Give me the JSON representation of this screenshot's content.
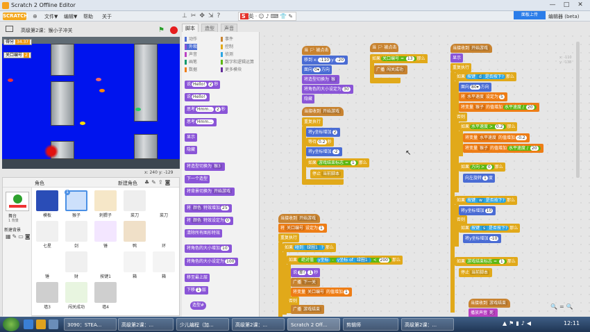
{
  "window": {
    "title": "Scratch 2 Offline Editor",
    "controls": [
      "—",
      "□",
      "✕"
    ]
  },
  "menu": {
    "logo": "SCRATCH",
    "items": [
      "文件▼",
      "编辑▼",
      "帮助",
      "关于"
    ]
  },
  "topright": {
    "online_badge": "面板上传",
    "editor_label": "编辑器 (beta)"
  },
  "stage": {
    "project_name": "高级第2课：猴小子冲关",
    "monitor1_label": "得分",
    "monitor1_value": "34.37",
    "monitor2_label": "关口编号",
    "monitor2_value": "2",
    "coords": "x: 240  y: -129"
  },
  "sprites": {
    "header": "角色",
    "new_sprite": "新建角色",
    "stage_label": "舞台",
    "stage_count": "1 背景",
    "new_backdrop": "新建背景",
    "items": [
      {
        "name": "模板"
      },
      {
        "name": "猴子",
        "badge": "1"
      },
      {
        "name": "刺猬子"
      },
      {
        "name": "菜刀"
      },
      {
        "name": "菜刀"
      },
      {
        "name": "七星"
      },
      {
        "name": "剑"
      },
      {
        "name": "锤"
      },
      {
        "name": "鸭"
      },
      {
        "name": "环"
      },
      {
        "name": "锤"
      },
      {
        "name": "财"
      },
      {
        "name": "按键1"
      },
      {
        "name": "箱"
      },
      {
        "name": "箱"
      },
      {
        "name": "墙3"
      },
      {
        "name": "闯关成功"
      },
      {
        "name": "墙4"
      }
    ]
  },
  "tabs": [
    "脚本",
    "造型",
    "声音"
  ],
  "categories": [
    {
      "label": "动作",
      "color": "#4a6cd4"
    },
    {
      "label": "事件",
      "color": "#c88330"
    },
    {
      "label": "外观",
      "color": "#8a55d7",
      "active": true
    },
    {
      "label": "控制",
      "color": "#e1a91a"
    },
    {
      "label": "声音",
      "color": "#bb42c3"
    },
    {
      "label": "侦测",
      "color": "#2ca5e2"
    },
    {
      "label": "画笔",
      "color": "#0e9a6c"
    },
    {
      "label": "数字和逻辑运算",
      "color": "#5cb712"
    },
    {
      "label": "数据",
      "color": "#ee7d16"
    },
    {
      "label": "更多模块",
      "color": "#632d99"
    }
  ],
  "palette": {
    "p1": [
      "说",
      "Hello!",
      "2",
      "秒"
    ],
    "p2": [
      "说",
      "Hello!"
    ],
    "p3": [
      "思考",
      "Hmm...",
      "2",
      "秒"
    ],
    "p4": [
      "思考",
      "Hmm..."
    ],
    "p5": "显示",
    "p6": "隐藏",
    "p7": [
      "将造型切换为",
      "猴3"
    ],
    "p8": "下一个造型",
    "p9": [
      "将背景切换为",
      "开始游戏"
    ],
    "p10": [
      "将",
      "颜色",
      "特效增加",
      "25"
    ],
    "p11": [
      "将",
      "颜色",
      "特效设定为",
      "0"
    ],
    "p12": "清除所有图形特效",
    "p13": [
      "将角色的大小增加",
      "10"
    ],
    "p14": [
      "将角色的大小设定为",
      "100"
    ],
    "p15": "移至最上层",
    "p16": [
      "下移",
      "1",
      "层"
    ],
    "p17": [
      "造型",
      "#"
    ]
  },
  "scripts": {
    "s1": {
      "hat": "当 🏳 被点击",
      "b1": [
        "移到 x:",
        "-110",
        "y:",
        "-20"
      ],
      "b2": [
        "面向",
        "0▾",
        "方向"
      ],
      "b3": [
        "将造型切换为",
        "猴"
      ],
      "b4": [
        "将角色的大小设定为",
        "30"
      ],
      "b5": "隐藏"
    },
    "s2": {
      "hat": [
        "当 🏳 被点击"
      ],
      "b1": [
        "如果",
        "关口编号",
        "=",
        "13",
        "那么"
      ],
      "b2": [
        "广播",
        "闯关成功"
      ]
    },
    "s3": {
      "hat": [
        "当接收到",
        "开始游戏"
      ],
      "loop": "重复执行",
      "b1": [
        "将y坐标增加",
        "2"
      ],
      "b2": [
        "等待",
        "0.2",
        "秒"
      ],
      "b3": [
        "将y坐标增加",
        "-2"
      ],
      "b4": [
        "如果",
        "游戏结束标志",
        "=",
        "1",
        "那么"
      ],
      "b5": [
        "停止",
        "当前脚本"
      ]
    },
    "s4": {
      "hat": [
        "当接收到",
        "开始游戏"
      ],
      "b0": "显示",
      "loop": "重复执行",
      "if1": [
        "如果",
        "按键",
        "d",
        "是否按下?",
        "那么"
      ],
      "b1": [
        "面向",
        "80▾",
        "方向"
      ],
      "b2": [
        "将",
        "水平速度",
        "设定为",
        "5"
      ],
      "b3": [
        "将变量",
        "猴子",
        "的值增加",
        "水平速度",
        "/",
        "20"
      ],
      "else": "否则",
      "if2": [
        "如果",
        "水平速度",
        ">",
        "0.2",
        "那么"
      ],
      "b4": [
        "将变量",
        "水平速度",
        "的值增加",
        "-0.2"
      ],
      "b5": [
        "将变量",
        "猴子",
        "的值增加",
        "水平速度",
        "/",
        "20"
      ],
      "if3": [
        "如果",
        "方向",
        ">",
        "0",
        "那么"
      ],
      "b6": [
        "向左旋转",
        "1",
        "度"
      ],
      "if4": [
        "如果",
        "按键",
        "w",
        "是否按下?",
        "那么"
      ],
      "b7": [
        "将y坐标增加",
        "10"
      ],
      "else2": "否则",
      "if5": [
        "如果",
        "按键",
        "s",
        "是否按下?",
        "那么"
      ],
      "b8": [
        "将y坐标增加",
        "-10"
      ],
      "if6": [
        "如果",
        "游戏结束标志",
        "=",
        "1",
        "那么"
      ],
      "b9": [
        "停止",
        "当前脚本"
      ]
    },
    "s5": {
      "hat": [
        "当接收到",
        "开始游戏"
      ],
      "b1": [
        "将",
        "关口编号",
        "设定为",
        "1"
      ],
      "loop": "重复执行",
      "if1": [
        "如果",
        "碰到",
        "绿圈1",
        "?",
        "那么"
      ],
      "if2": [
        "如果",
        "绝对值",
        "y坐标",
        "-",
        "y坐标",
        "of",
        "绿圈1",
        "<",
        "200",
        "那么"
      ],
      "b2": [
        "说",
        "耶!",
        "1",
        "秒"
      ],
      "b3": [
        "广播",
        "下一关"
      ],
      "b4": [
        "将变量",
        "关口编号",
        "的值增加",
        "1"
      ],
      "else": "否则",
      "b5": [
        "广播",
        "游戏结束"
      ]
    },
    "s6": {
      "hat": [
        "当接收到",
        "游戏结束"
      ],
      "b1": [
        "播放声音",
        "死"
      ]
    }
  },
  "xy_readout": [
    "x: -110",
    "y: -138"
  ],
  "taskbar": {
    "tasks": [
      "3090：STEA...",
      "高级第2课：...",
      "少儿编程（加...",
      "高级第2课：...",
      "Scratch 2 Off...",
      "剪辑师",
      "高级第2课：..."
    ],
    "clock": "12:11"
  }
}
